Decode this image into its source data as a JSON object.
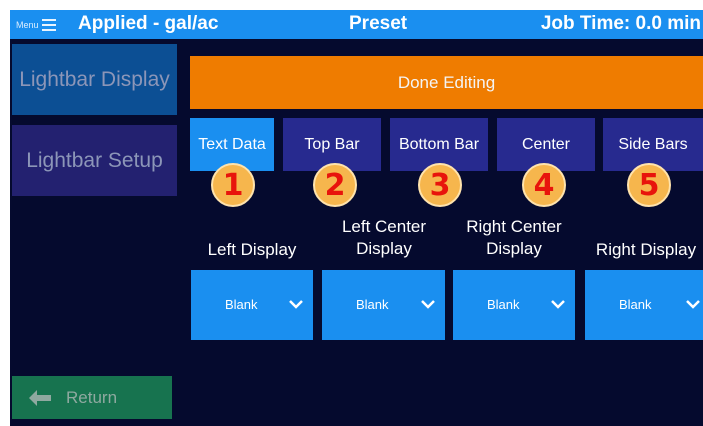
{
  "colors": {
    "header_bg": "#1a8ff0",
    "screen_bg": "#050a2e",
    "done_bg": "#ef7c00",
    "tab_active_bg": "#1a8ff0",
    "tab_inactive_bg": "#272a8f",
    "return_bg": "#17734f",
    "badge_bg": "#f6b64d",
    "badge_text": "#e8140c"
  },
  "header": {
    "menu_label": "Menu",
    "applied": "Applied - gal/ac",
    "preset": "Preset",
    "job_time": "Job Time: 0.0 min"
  },
  "sidebar": {
    "items": [
      {
        "label": "Lightbar Display",
        "active": true
      },
      {
        "label": "Lightbar Setup",
        "active": false
      }
    ],
    "return_label": "Return",
    "return_icon": "left-arrow-icon"
  },
  "done_label": "Done Editing",
  "tabs": [
    {
      "label": "Text Data",
      "active": true
    },
    {
      "label": "Top Bar",
      "active": false
    },
    {
      "label": "Bottom Bar",
      "active": false
    },
    {
      "label": "Center",
      "active": false
    },
    {
      "label": "Side Bars",
      "active": false
    }
  ],
  "badges": [
    "1",
    "2",
    "3",
    "4",
    "5"
  ],
  "displays": [
    {
      "label": "Left Display",
      "value": "Blank"
    },
    {
      "label": "Left Center Display",
      "value": "Blank"
    },
    {
      "label": "Right Center Display",
      "value": "Blank"
    },
    {
      "label": "Right Display",
      "value": "Blank"
    }
  ]
}
